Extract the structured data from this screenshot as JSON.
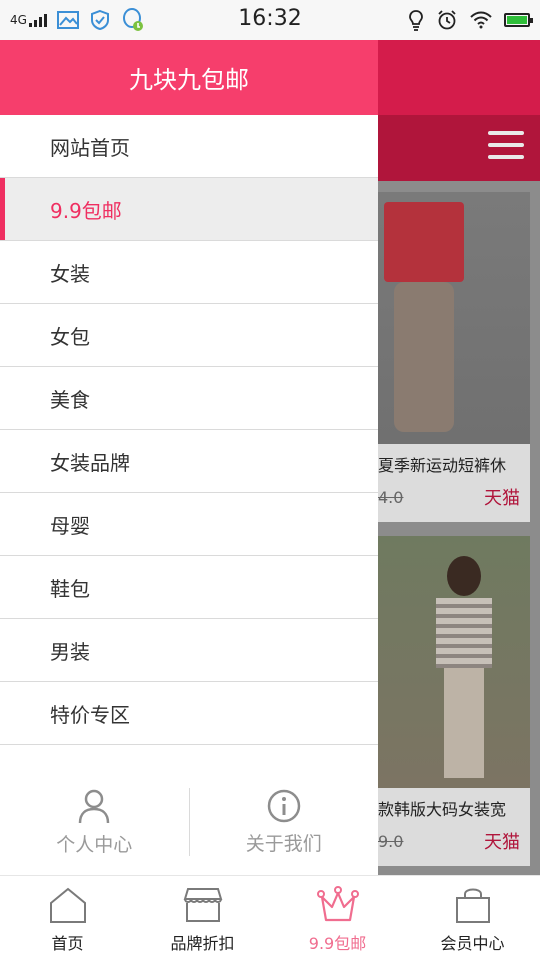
{
  "status_bar": {
    "network": "4G",
    "time": "16:32",
    "battery_level": 1.0,
    "battery_color": "#2fbf3a"
  },
  "header": {
    "title": "九块九包邮"
  },
  "colors": {
    "accent": "#f63e6c",
    "active_text": "#ef2f61",
    "background_header": "#d41c4b"
  },
  "drawer": {
    "items": [
      {
        "label": "网站首页",
        "active": false
      },
      {
        "label": "9.9包邮",
        "active": true
      },
      {
        "label": "女装",
        "active": false
      },
      {
        "label": "女包",
        "active": false
      },
      {
        "label": "美食",
        "active": false
      },
      {
        "label": "女装品牌",
        "active": false
      },
      {
        "label": "母婴",
        "active": false
      },
      {
        "label": "鞋包",
        "active": false
      },
      {
        "label": "男装",
        "active": false
      },
      {
        "label": "特价专区",
        "active": false
      }
    ],
    "footer": {
      "profile_label": "个人中心",
      "about_label": "关于我们"
    }
  },
  "background": {
    "products": [
      {
        "name": "夏季新运动短裤休",
        "old_price": "4.0",
        "tag": "天猫"
      },
      {
        "name": "款韩版大码女装宽",
        "old_price": "9.0",
        "tag": "天猫"
      }
    ]
  },
  "tabbar": {
    "tabs": [
      {
        "label": "首页",
        "icon": "home-icon",
        "active": false
      },
      {
        "label": "品牌折扣",
        "icon": "store-icon",
        "active": false
      },
      {
        "label": "9.9包邮",
        "icon": "crown-icon",
        "active": true
      },
      {
        "label": "会员中心",
        "icon": "bag-icon",
        "active": false
      }
    ]
  }
}
